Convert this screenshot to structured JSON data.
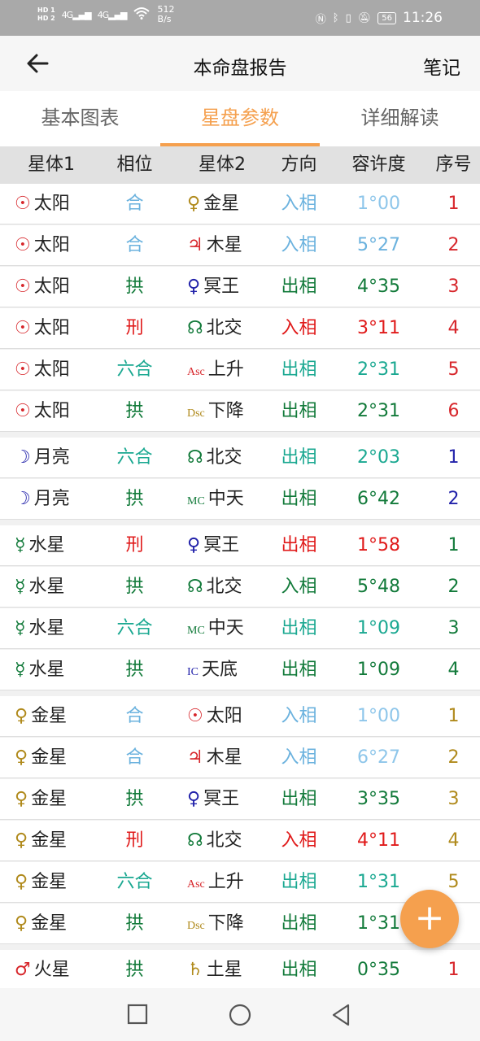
{
  "status": {
    "hd1": "HD 1",
    "hd2": "HD 2",
    "sig1": "4G",
    "sig2": "4G",
    "speed_value": "512",
    "speed_unit": "B/s",
    "battery": "56",
    "time": "11:26"
  },
  "header": {
    "title": "本命盘报告",
    "notes": "笔记"
  },
  "tabs": [
    {
      "label": "基本图表"
    },
    {
      "label": "星盘参数"
    },
    {
      "label": "详细解读"
    }
  ],
  "columns": [
    "星体1",
    "相位",
    "星体2",
    "方向",
    "容许度",
    "序号"
  ],
  "rows": [
    {
      "p1_sym": "☉",
      "p1": "太阳",
      "p1c": "#d7262b",
      "asp": "合",
      "ac": "#6bb2de",
      "p2_sym": "♀",
      "p2": "金星",
      "p2c": "#b08a1c",
      "dir": "入相",
      "dc": "#6bb2de",
      "orb": "1°00",
      "oc": "#8ec6ea",
      "n": "1",
      "nc": "#d7262b"
    },
    {
      "p1_sym": "☉",
      "p1": "太阳",
      "p1c": "#d7262b",
      "asp": "合",
      "ac": "#6bb2de",
      "p2_sym": "♃",
      "p2": "木星",
      "p2c": "#d7262b",
      "dir": "入相",
      "dc": "#6bb2de",
      "orb": "5°27",
      "oc": "#6bb2de",
      "n": "2",
      "nc": "#d7262b"
    },
    {
      "p1_sym": "☉",
      "p1": "太阳",
      "p1c": "#d7262b",
      "asp": "拱",
      "ac": "#127a3a",
      "p2_sym": "♀",
      "p2": "冥王",
      "p2c": "#2222aa",
      "dir": "出相",
      "dc": "#127a3a",
      "orb": "4°35",
      "oc": "#127a3a",
      "n": "3",
      "nc": "#d7262b"
    },
    {
      "p1_sym": "☉",
      "p1": "太阳",
      "p1c": "#d7262b",
      "asp": "刑",
      "ac": "#e01a1a",
      "p2_sym": "☊",
      "p2": "北交",
      "p2c": "#127a3a",
      "dir": "入相",
      "dc": "#e01a1a",
      "orb": "3°11",
      "oc": "#e01a1a",
      "n": "4",
      "nc": "#d7262b"
    },
    {
      "p1_sym": "☉",
      "p1": "太阳",
      "p1c": "#d7262b",
      "asp": "六合",
      "ac": "#1aa891",
      "p2_sym": "Asc",
      "p2": "上升",
      "p2c": "#d7262b",
      "dir": "出相",
      "dc": "#1aa891",
      "orb": "2°31",
      "oc": "#1aa891",
      "n": "5",
      "nc": "#d7262b"
    },
    {
      "p1_sym": "☉",
      "p1": "太阳",
      "p1c": "#d7262b",
      "asp": "拱",
      "ac": "#127a3a",
      "p2_sym": "Dsc",
      "p2": "下降",
      "p2c": "#b08a1c",
      "dir": "出相",
      "dc": "#127a3a",
      "orb": "2°31",
      "oc": "#127a3a",
      "n": "6",
      "nc": "#d7262b"
    },
    {
      "p1_sym": "☽",
      "p1": "月亮",
      "p1c": "#2222aa",
      "asp": "六合",
      "ac": "#1aa891",
      "p2_sym": "☊",
      "p2": "北交",
      "p2c": "#127a3a",
      "dir": "出相",
      "dc": "#1aa891",
      "orb": "2°03",
      "oc": "#1aa891",
      "n": "1",
      "nc": "#2222aa",
      "gap": true
    },
    {
      "p1_sym": "☽",
      "p1": "月亮",
      "p1c": "#2222aa",
      "asp": "拱",
      "ac": "#127a3a",
      "p2_sym": "MC",
      "p2": "中天",
      "p2c": "#127a3a",
      "dir": "出相",
      "dc": "#127a3a",
      "orb": "6°42",
      "oc": "#127a3a",
      "n": "2",
      "nc": "#2222aa"
    },
    {
      "p1_sym": "☿",
      "p1": "水星",
      "p1c": "#127a3a",
      "asp": "刑",
      "ac": "#e01a1a",
      "p2_sym": "♀",
      "p2": "冥王",
      "p2c": "#2222aa",
      "dir": "出相",
      "dc": "#e01a1a",
      "orb": "1°58",
      "oc": "#e01a1a",
      "n": "1",
      "nc": "#127a3a",
      "gap": true
    },
    {
      "p1_sym": "☿",
      "p1": "水星",
      "p1c": "#127a3a",
      "asp": "拱",
      "ac": "#127a3a",
      "p2_sym": "☊",
      "p2": "北交",
      "p2c": "#127a3a",
      "dir": "入相",
      "dc": "#127a3a",
      "orb": "5°48",
      "oc": "#127a3a",
      "n": "2",
      "nc": "#127a3a"
    },
    {
      "p1_sym": "☿",
      "p1": "水星",
      "p1c": "#127a3a",
      "asp": "六合",
      "ac": "#1aa891",
      "p2_sym": "MC",
      "p2": "中天",
      "p2c": "#127a3a",
      "dir": "出相",
      "dc": "#1aa891",
      "orb": "1°09",
      "oc": "#1aa891",
      "n": "3",
      "nc": "#127a3a"
    },
    {
      "p1_sym": "☿",
      "p1": "水星",
      "p1c": "#127a3a",
      "asp": "拱",
      "ac": "#127a3a",
      "p2_sym": "IC",
      "p2": "天底",
      "p2c": "#2222aa",
      "dir": "出相",
      "dc": "#127a3a",
      "orb": "1°09",
      "oc": "#127a3a",
      "n": "4",
      "nc": "#127a3a"
    },
    {
      "p1_sym": "♀",
      "p1": "金星",
      "p1c": "#b08a1c",
      "asp": "合",
      "ac": "#6bb2de",
      "p2_sym": "☉",
      "p2": "太阳",
      "p2c": "#d7262b",
      "dir": "入相",
      "dc": "#6bb2de",
      "orb": "1°00",
      "oc": "#8ec6ea",
      "n": "1",
      "nc": "#b08a1c",
      "gap": true
    },
    {
      "p1_sym": "♀",
      "p1": "金星",
      "p1c": "#b08a1c",
      "asp": "合",
      "ac": "#6bb2de",
      "p2_sym": "♃",
      "p2": "木星",
      "p2c": "#d7262b",
      "dir": "入相",
      "dc": "#6bb2de",
      "orb": "6°27",
      "oc": "#8ec6ea",
      "n": "2",
      "nc": "#b08a1c"
    },
    {
      "p1_sym": "♀",
      "p1": "金星",
      "p1c": "#b08a1c",
      "asp": "拱",
      "ac": "#127a3a",
      "p2_sym": "♀",
      "p2": "冥王",
      "p2c": "#2222aa",
      "dir": "出相",
      "dc": "#127a3a",
      "orb": "3°35",
      "oc": "#127a3a",
      "n": "3",
      "nc": "#b08a1c"
    },
    {
      "p1_sym": "♀",
      "p1": "金星",
      "p1c": "#b08a1c",
      "asp": "刑",
      "ac": "#e01a1a",
      "p2_sym": "☊",
      "p2": "北交",
      "p2c": "#127a3a",
      "dir": "入相",
      "dc": "#e01a1a",
      "orb": "4°11",
      "oc": "#e01a1a",
      "n": "4",
      "nc": "#b08a1c"
    },
    {
      "p1_sym": "♀",
      "p1": "金星",
      "p1c": "#b08a1c",
      "asp": "六合",
      "ac": "#1aa891",
      "p2_sym": "Asc",
      "p2": "上升",
      "p2c": "#d7262b",
      "dir": "出相",
      "dc": "#1aa891",
      "orb": "1°31",
      "oc": "#1aa891",
      "n": "5",
      "nc": "#b08a1c"
    },
    {
      "p1_sym": "♀",
      "p1": "金星",
      "p1c": "#b08a1c",
      "asp": "拱",
      "ac": "#127a3a",
      "p2_sym": "Dsc",
      "p2": "下降",
      "p2c": "#b08a1c",
      "dir": "出相",
      "dc": "#127a3a",
      "orb": "1°31",
      "oc": "#127a3a",
      "n": "",
      "nc": "#b08a1c"
    },
    {
      "p1_sym": "♂",
      "p1": "火星",
      "p1c": "#d7262b",
      "asp": "拱",
      "ac": "#127a3a",
      "p2_sym": "♄",
      "p2": "土星",
      "p2c": "#b08a1c",
      "dir": "出相",
      "dc": "#127a3a",
      "orb": "0°35",
      "oc": "#127a3a",
      "n": "1",
      "nc": "#d7262b",
      "gap": true
    }
  ],
  "fab": {
    "label": "+"
  },
  "icons": {
    "back": "back-arrow-icon",
    "nav_recent": "square-icon",
    "nav_home": "circle-icon",
    "nav_back": "triangle-icon"
  }
}
